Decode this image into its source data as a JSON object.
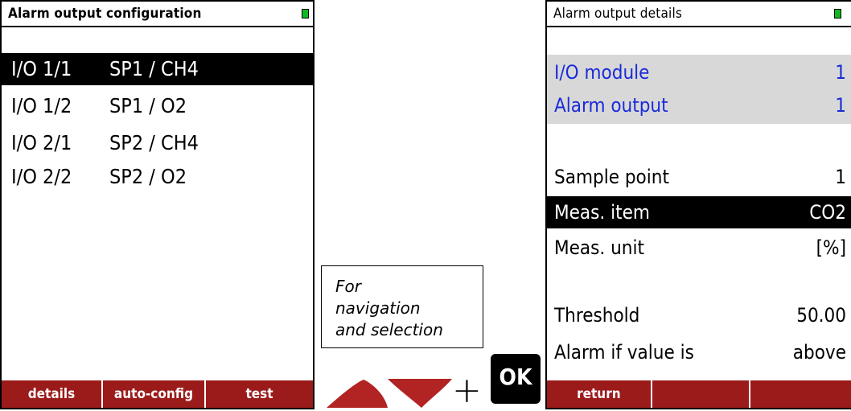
{
  "left_screen": {
    "title": "Alarm output configuration",
    "status_led_color": "#10b820",
    "rows": [
      {
        "io": "I/O 1/1",
        "sp": "SP1 / CH4",
        "selected": true
      },
      {
        "io": "I/O 1/2",
        "sp": "SP1 / O2",
        "selected": false
      },
      {
        "io": "I/O 2/1",
        "sp": "SP2 / CH4",
        "selected": false
      },
      {
        "io": "I/O 2/2",
        "sp": "SP2 / O2",
        "selected": false
      }
    ],
    "softkeys": [
      "details",
      "auto-config",
      "test"
    ]
  },
  "right_screen": {
    "title": "Alarm output details",
    "status_led_color": "#10b820",
    "module_label": "I/O module",
    "module_value": "1",
    "alarm_output_label": "Alarm output",
    "alarm_output_value": "1",
    "sample_point_label": "Sample point",
    "sample_point_value": "1",
    "meas_item_label": "Meas. item",
    "meas_item_value": "CO2",
    "meas_unit_label": "Meas. unit",
    "meas_unit_value": "[%]",
    "threshold_label": "Threshold",
    "threshold_value": "50.00",
    "alarm_if_label": "Alarm if value is",
    "alarm_if_value": "above",
    "softkeys": [
      "return",
      "",
      ""
    ]
  },
  "note": {
    "lines": [
      "For",
      "navigation",
      "and selection"
    ]
  },
  "keys": {
    "up_arrow_icon": "up-arrow-key-icon",
    "down_arrow_icon": "down-arrow-key-icon",
    "plus": "+",
    "ok_label": "OK",
    "arrow_color": "#b22323"
  },
  "colors": {
    "footer": "#9b1b1b",
    "highlight_blue": "#1a2bd8",
    "info_block": "#d8d8d8"
  }
}
